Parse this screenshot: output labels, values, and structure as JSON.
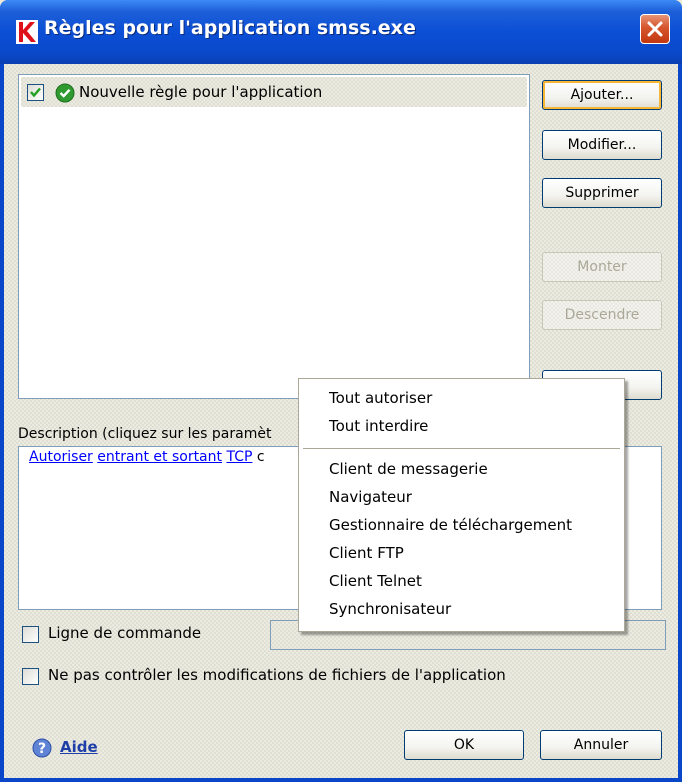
{
  "window": {
    "title": "Règles pour l'application smss.exe",
    "icon": "kaspersky-k-icon",
    "close": "close-icon"
  },
  "rules": [
    {
      "label": "Nouvelle règle pour l'application",
      "checked": true,
      "status_icon": "check-circle-icon"
    }
  ],
  "buttons": {
    "add": "Ajouter...",
    "modify": "Modifier...",
    "delete": "Supprimer",
    "up": "Monter",
    "down": "Descendre",
    "ok": "OK",
    "cancel": "Annuler"
  },
  "description": {
    "label": "Description (cliquez sur les paramèt",
    "links": [
      "Autoriser",
      "entrant et sortant",
      "TCP"
    ],
    "tail": "c"
  },
  "options": {
    "command_line": "Ligne de commande",
    "no_control": "Ne pas contrôler les modifications de fichiers de l'application"
  },
  "help": {
    "label": "Aide",
    "icon": "help-icon"
  },
  "menu": {
    "group1": [
      "Tout autoriser",
      "Tout interdire"
    ],
    "group2": [
      "Client de messagerie",
      "Navigateur",
      "Gestionnaire de téléchargement",
      "Client FTP",
      "Client Telnet",
      "Synchronisateur"
    ]
  },
  "colors": {
    "titlebar": "#0b4fd6",
    "link": "#0000ff",
    "close_red": "#d6552d"
  }
}
